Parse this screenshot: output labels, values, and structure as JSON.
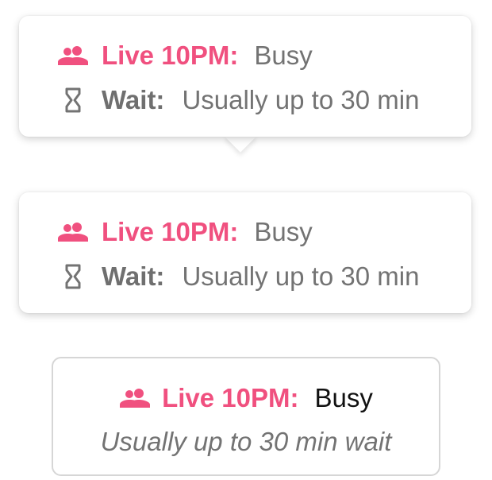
{
  "colors": {
    "accent": "#f0507f",
    "muted_text": "#737373",
    "dark_text": "#111111",
    "border": "#d6d6d6"
  },
  "cards": [
    {
      "variant": "tooltip-with-pointer",
      "live_icon": "people-icon",
      "live_label": "Live 10PM:",
      "live_value": "Busy",
      "wait_icon": "hourglass-icon",
      "wait_label": "Wait:",
      "wait_value": "Usually up to 30 min"
    },
    {
      "variant": "tooltip",
      "live_icon": "people-icon",
      "live_label": "Live 10PM:",
      "live_value": "Busy",
      "wait_icon": "hourglass-icon",
      "wait_label": "Wait:",
      "wait_value": "Usually up to 30 min"
    },
    {
      "variant": "outlined",
      "live_icon": "people-icon",
      "live_label": "Live 10PM:",
      "live_value": "Busy",
      "wait_text": "Usually up to 30 min wait"
    }
  ]
}
